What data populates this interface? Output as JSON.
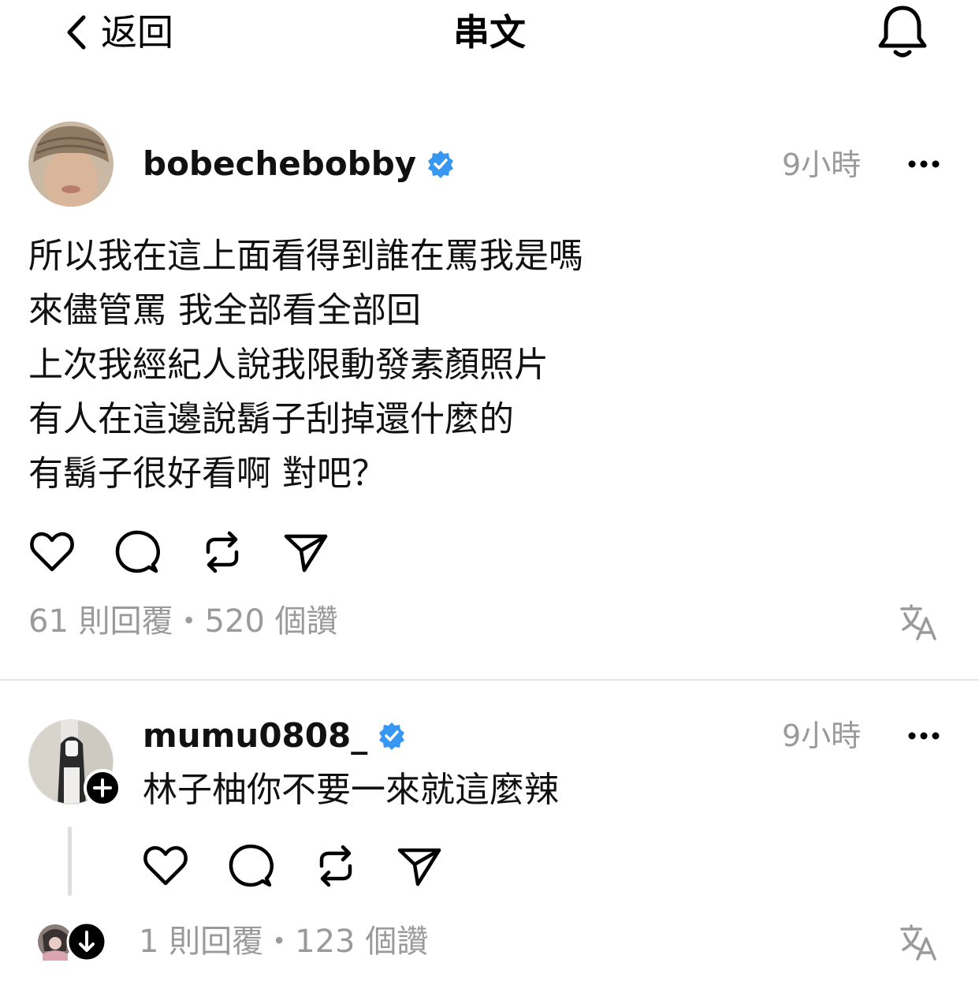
{
  "nav": {
    "back_label": "返回",
    "title": "串文",
    "back_icon": "chevron-left-icon",
    "bell_icon": "bell-icon"
  },
  "post": {
    "username": "bobechebobby",
    "verified": true,
    "time": "9小時",
    "lines": [
      "所以我在這上面看得到誰在罵我是嗎",
      "來儘管罵 我全部看全部回",
      "上次我經紀人說我限動發素顏照片",
      "有人在這邊說鬍子刮掉還什麼的",
      "有鬍子很好看啊 對吧？"
    ],
    "stats": "61 則回覆・520 個讚"
  },
  "reply": {
    "username": "mumu0808_",
    "verified": true,
    "time": "9小時",
    "text": "林子柚你不要一來就這麼辣",
    "stats": "1 則回覆・123 個讚"
  },
  "colors": {
    "verified_blue": "#3897f0",
    "muted_gray": "#9a9a9a"
  }
}
